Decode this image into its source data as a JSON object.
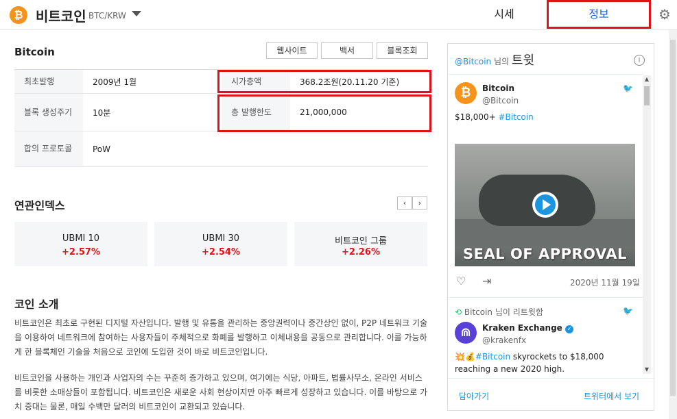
{
  "header": {
    "coin_symbol_glyph": "₿",
    "coin_name": "비트코인",
    "coin_pair": "BTC/KRW",
    "tabs": [
      {
        "label": "시세",
        "active": false
      },
      {
        "label": "정보",
        "active": true
      }
    ],
    "accent_color": "#1a5fc9",
    "highlight_color": "#e0111b"
  },
  "coin_info": {
    "title": "Bitcoin",
    "buttons": {
      "website": "웹사이트",
      "whitepaper": "백서",
      "explorer": "블록조회"
    },
    "rows": [
      {
        "label_a": "최초발행",
        "value_a": "2009년 1월",
        "label_b": "시가총액",
        "value_b": "368.2조원(20.11.20 기준)"
      },
      {
        "label_a": "블록 생성주기",
        "value_a": "10분",
        "label_b": "총 발행한도",
        "value_b": "21,000,000"
      },
      {
        "label_a": "합의 프로토콜",
        "value_a": "PoW"
      }
    ]
  },
  "related_index": {
    "title": "연관인덱스",
    "prev_label": "‹",
    "next_label": "›",
    "cards": [
      {
        "name": "UBMI 10",
        "change": "+2.57%"
      },
      {
        "name": "UBMI 30",
        "change": "+2.54%"
      },
      {
        "name": "비트코인 그룹",
        "change": "+2.26%"
      }
    ]
  },
  "intro": {
    "title": "코인 소개",
    "para1": "비트코인은 최초로 구현된 디지털 자산입니다. 발행 및 유통을 관리하는 중앙권력이나 중간상인 없이, P2P 네트워크 기술을 이용하여 네트워크에 참여하는 사용자들이 주체적으로 화폐를 발행하고 이체내용을 공동으로 관리합니다. 이를 가능하게 한 블록체인 기술을 처음으로 코인에 도입한 것이 바로 비트코인입니다.",
    "para2": "비트코인을 사용하는 개인과 사업자의 수는 꾸준히 증가하고 있으며, 여기에는 식당, 아파트, 법률사무소, 온라인 서비스를 비롯한 소매상들이 포함됩니다. 비트코인은 새로운 사회 현상이지만 아주 빠르게 성장하고 있습니다. 이를 바탕으로 가치 증대는 물론, 매일 수백만 달러의 비트코인이 교환되고 있습니다."
  },
  "twitter": {
    "header_handle": "@Bitcoin",
    "header_suffix": "님의",
    "header_word": "트윗",
    "info_glyph": "i",
    "tweet1": {
      "avatar_glyph": "₿",
      "name": "Bitcoin",
      "handle": "@Bitcoin",
      "text_prefix": "$18,000+ ",
      "hashtag": "#Bitcoin",
      "media_caption": "SEAL OF APPROVAL",
      "date": "2020년 11월 19일"
    },
    "retweet": {
      "retweeter": "Bitcoin",
      "retweet_suffix": "님이 리트윗함",
      "name": "Kraken Exchange",
      "handle": "@krakenfx",
      "text_emoji": "💥💰",
      "hashtag": "#Bitcoin",
      "text_rest": " skyrockets to $18,000 reaching a new 2020 high."
    },
    "footer": {
      "embed": "담아가기",
      "view_on_twitter": "트위터에서 보기"
    }
  }
}
